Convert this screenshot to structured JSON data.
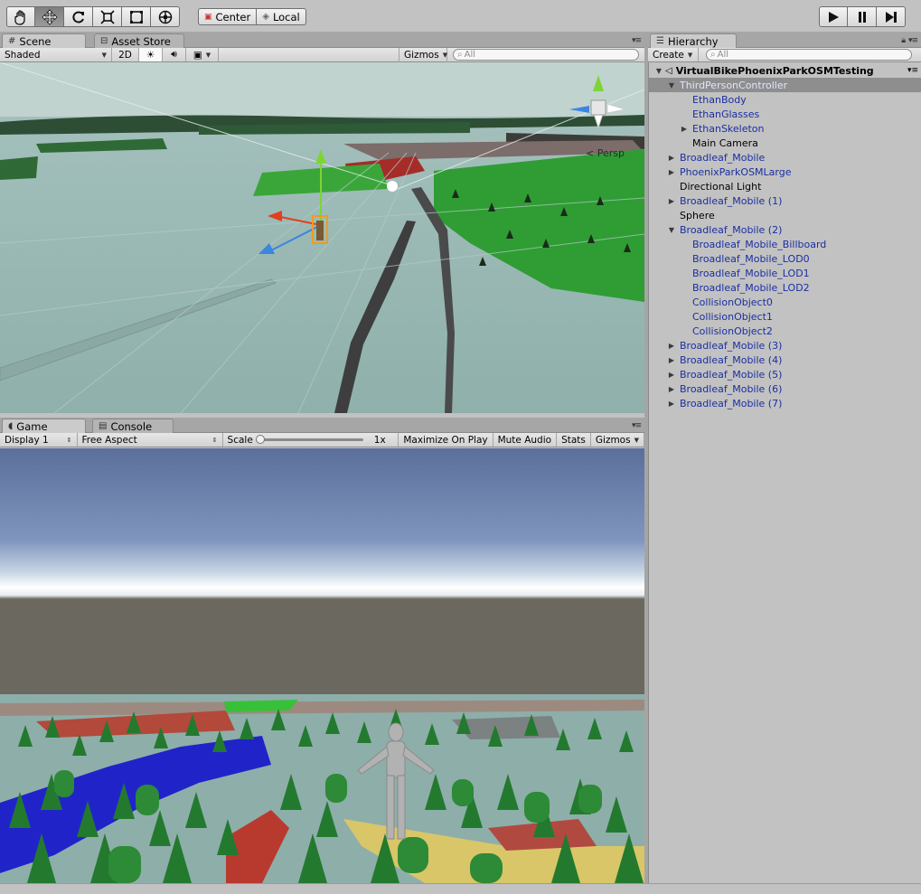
{
  "toolbar": {
    "tools": [
      {
        "name": "hand-tool",
        "icon": "hand-icon",
        "active": false
      },
      {
        "name": "move-tool",
        "icon": "move-arrows-icon",
        "active": true
      },
      {
        "name": "rotate-tool",
        "icon": "rotate-icon",
        "active": false
      },
      {
        "name": "scale-tool",
        "icon": "scale-icon",
        "active": false
      },
      {
        "name": "rect-tool",
        "icon": "rect-icon",
        "active": false
      },
      {
        "name": "transform-tool",
        "icon": "transform-icon",
        "active": false
      }
    ],
    "pivot_label": "Center",
    "space_label": "Local"
  },
  "scene_panel": {
    "tabs": [
      "Scene",
      "Asset Store"
    ],
    "shading_mode": "Shaded",
    "mode_2d": "2D",
    "gizmos_label": "Gizmos",
    "search_placeholder": "All",
    "persp_label": "< Persp"
  },
  "game_panel": {
    "tabs": [
      "Game",
      "Console"
    ],
    "display": "Display 1",
    "aspect": "Free Aspect",
    "scale_label": "Scale",
    "scale_value": "1x",
    "maximize_label": "Maximize On Play",
    "mute_label": "Mute Audio",
    "stats_label": "Stats",
    "gizmos_label": "Gizmos"
  },
  "hierarchy": {
    "tab": "Hierarchy",
    "create_label": "Create",
    "search_placeholder": "All",
    "items": [
      {
        "label": "VirtualBikePhoenixParkOSMTesting",
        "depth": 0,
        "arrow": "down",
        "style": "root"
      },
      {
        "label": "ThirdPersonController",
        "depth": 1,
        "arrow": "down",
        "style": "prefab",
        "selected": true
      },
      {
        "label": "EthanBody",
        "depth": 2,
        "arrow": "",
        "style": "prefab"
      },
      {
        "label": "EthanGlasses",
        "depth": 2,
        "arrow": "",
        "style": "prefab"
      },
      {
        "label": "EthanSkeleton",
        "depth": 2,
        "arrow": "right",
        "style": "prefab"
      },
      {
        "label": "Main Camera",
        "depth": 2,
        "arrow": "",
        "style": "plain"
      },
      {
        "label": "Broadleaf_Mobile",
        "depth": 1,
        "arrow": "right",
        "style": "prefab"
      },
      {
        "label": "PhoenixParkOSMLarge",
        "depth": 1,
        "arrow": "right",
        "style": "prefab"
      },
      {
        "label": "Directional Light",
        "depth": 1,
        "arrow": "",
        "style": "plain"
      },
      {
        "label": "Broadleaf_Mobile (1)",
        "depth": 1,
        "arrow": "right",
        "style": "prefab"
      },
      {
        "label": "Sphere",
        "depth": 1,
        "arrow": "",
        "style": "plain"
      },
      {
        "label": "Broadleaf_Mobile (2)",
        "depth": 1,
        "arrow": "down",
        "style": "prefab"
      },
      {
        "label": "Broadleaf_Mobile_Billboard",
        "depth": 2,
        "arrow": "",
        "style": "prefab"
      },
      {
        "label": "Broadleaf_Mobile_LOD0",
        "depth": 2,
        "arrow": "",
        "style": "prefab"
      },
      {
        "label": "Broadleaf_Mobile_LOD1",
        "depth": 2,
        "arrow": "",
        "style": "prefab"
      },
      {
        "label": "Broadleaf_Mobile_LOD2",
        "depth": 2,
        "arrow": "",
        "style": "prefab"
      },
      {
        "label": "CollisionObject0",
        "depth": 2,
        "arrow": "",
        "style": "prefab"
      },
      {
        "label": "CollisionObject1",
        "depth": 2,
        "arrow": "",
        "style": "prefab"
      },
      {
        "label": "CollisionObject2",
        "depth": 2,
        "arrow": "",
        "style": "prefab"
      },
      {
        "label": "Broadleaf_Mobile (3)",
        "depth": 1,
        "arrow": "right",
        "style": "prefab"
      },
      {
        "label": "Broadleaf_Mobile (4)",
        "depth": 1,
        "arrow": "right",
        "style": "prefab"
      },
      {
        "label": "Broadleaf_Mobile (5)",
        "depth": 1,
        "arrow": "right",
        "style": "prefab"
      },
      {
        "label": "Broadleaf_Mobile (6)",
        "depth": 1,
        "arrow": "right",
        "style": "prefab"
      },
      {
        "label": "Broadleaf_Mobile (7)",
        "depth": 1,
        "arrow": "right",
        "style": "prefab"
      }
    ]
  },
  "colors": {
    "prefab_text": "#1b2fa0",
    "selected_row": "#8e8e8e",
    "panel_bg": "#c2c2c2"
  }
}
